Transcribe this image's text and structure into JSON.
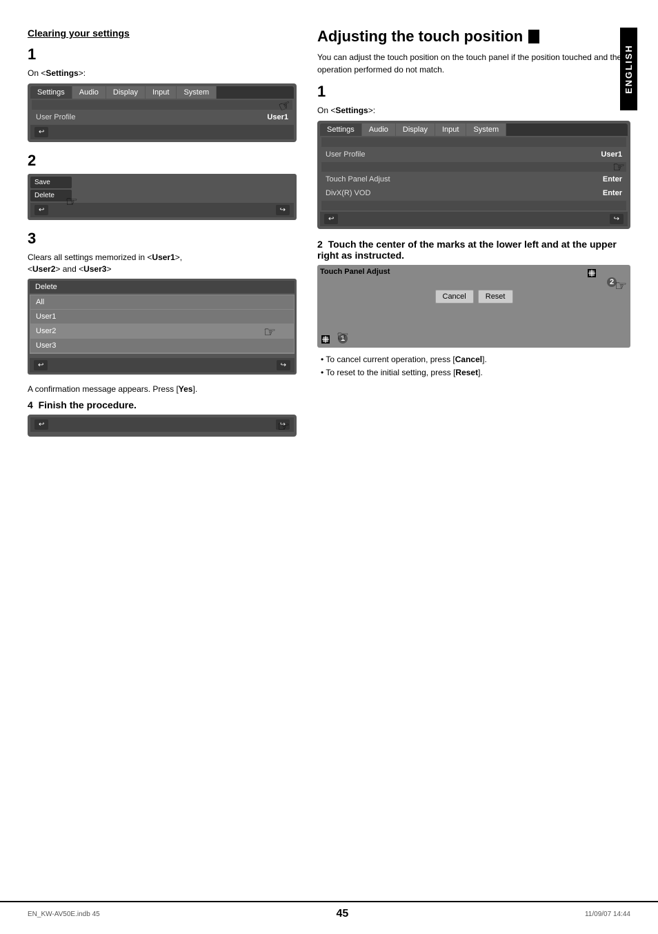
{
  "page": {
    "number": "45",
    "footer_left": "EN_KW-AV50E.indb   45",
    "footer_right": "11/09/07   14:44"
  },
  "left_section": {
    "title": "Clearing your settings",
    "step1": {
      "label": "1",
      "text": "On <Settings>:",
      "screen1": {
        "tab_settings": "Settings",
        "tab_audio": "Audio",
        "tab_display": "Display",
        "tab_input": "Input",
        "tab_system": "System",
        "row_label": "User Profile",
        "row_value": "User1"
      }
    },
    "step2": {
      "label": "2",
      "save_btn": "Save",
      "delete_btn": "Delete"
    },
    "step3": {
      "label": "3",
      "clears_text": "Clears all settings memorized in <User1>,\n<User2> and <User3>",
      "delete_title": "Delete",
      "items": [
        "All",
        "User1",
        "User2",
        "User3"
      ]
    },
    "confirm_text": "A confirmation message appears. Press [Yes].",
    "step4": {
      "label": "4",
      "text": "Finish the procedure."
    }
  },
  "right_section": {
    "title": "Adjusting the touch position",
    "intro": "You can adjust the touch position on the touch panel if the position touched and the operation performed do not match.",
    "step1": {
      "label": "1",
      "text": "On <Settings>:",
      "screen1": {
        "tab_settings": "Settings",
        "tab_audio": "Audio",
        "tab_display": "Display",
        "tab_input": "Input",
        "tab_system": "System",
        "row_label": "User Profile",
        "row_value": "User1",
        "row2_label": "Touch Panel Adjust",
        "row2_value": "Enter",
        "row3_label": "DivX(R) VOD",
        "row3_value": "Enter"
      }
    },
    "step2": {
      "label": "2",
      "text": "Touch the center of the marks at the lower left and at the upper right as instructed.",
      "screen": {
        "title": "Touch Panel Adjust",
        "cancel_btn": "Cancel",
        "reset_btn": "Reset"
      },
      "circle1": "1",
      "circle2": "2"
    },
    "bullets": [
      "To cancel current operation, press [Cancel].",
      "To reset to the initial setting, press [Reset]."
    ],
    "english_label": "ENGLISH"
  }
}
